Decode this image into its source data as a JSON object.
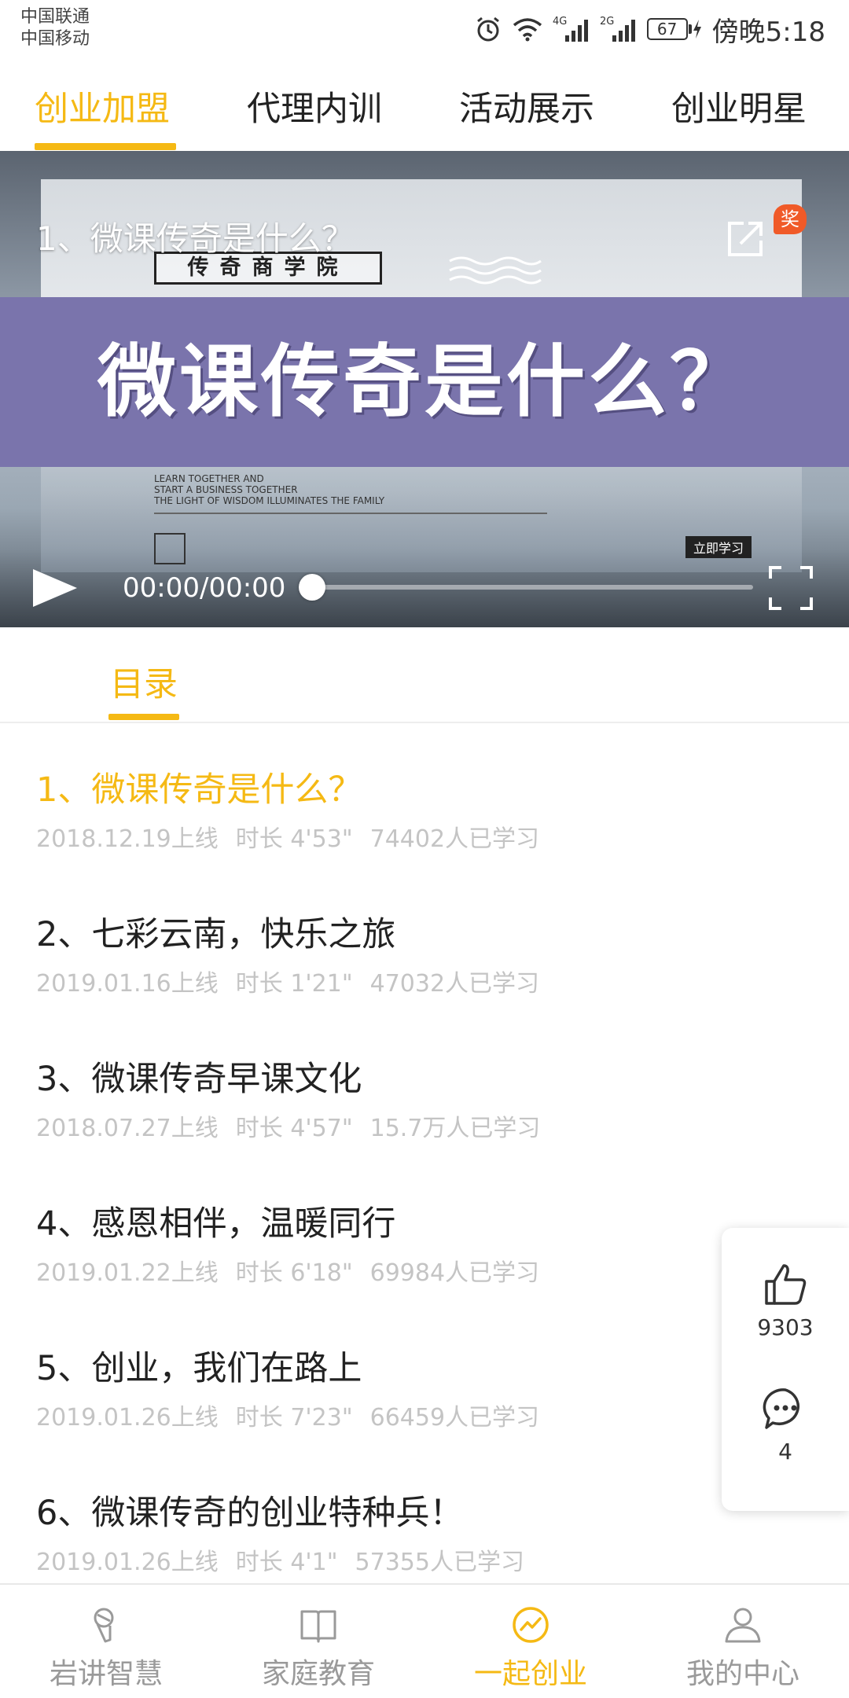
{
  "status_bar": {
    "carrier_1": "中国联通",
    "carrier_2": "中国移动",
    "network_4g": "4G",
    "network_2g": "2G",
    "battery": "67",
    "time": "傍晚5:18"
  },
  "top_tabs": [
    {
      "label": "创业加盟",
      "active": true
    },
    {
      "label": "代理内训",
      "active": false
    },
    {
      "label": "活动展示",
      "active": false
    },
    {
      "label": "创业明星",
      "active": false
    }
  ],
  "video": {
    "title": "1、微课传奇是什么？",
    "poster_academy": "传奇商学院",
    "poster_title": "微课传奇是什么？",
    "poster_tagline_1": "LEARN TOGETHER AND",
    "poster_tagline_2": "START A BUSINESS TOGETHER",
    "poster_tagline_3": "THE LIGHT OF WISDOM ILLUMINATES THE FAMILY",
    "poster_button": "立即学习",
    "award_badge": "奖",
    "time": "00:00/00:00",
    "progress": 0
  },
  "catalog": {
    "tab_label": "目录"
  },
  "courses": [
    {
      "title": "1、微课传奇是什么？",
      "date": "2018.12.19上线",
      "duration": "时长 4'53\"",
      "learners": "74402人已学习",
      "active": true
    },
    {
      "title": "2、七彩云南，快乐之旅",
      "date": "2019.01.16上线",
      "duration": "时长 1'21\"",
      "learners": "47032人已学习",
      "active": false
    },
    {
      "title": "3、微课传奇早课文化",
      "date": "2018.07.27上线",
      "duration": "时长 4'57\"",
      "learners": "15.7万人已学习",
      "active": false
    },
    {
      "title": "4、感恩相伴，温暖同行",
      "date": "2019.01.22上线",
      "duration": "时长 6'18\"",
      "learners": "69984人已学习",
      "active": false
    },
    {
      "title": "5、创业，我们在路上",
      "date": "2019.01.26上线",
      "duration": "时长 7'23\"",
      "learners": "66459人已学习",
      "active": false
    },
    {
      "title": "6、微课传奇的创业特种兵！",
      "date": "2019.01.26上线",
      "duration": "时长 4'1\"",
      "learners": "57355人已学习",
      "active": false
    }
  ],
  "side_panel": {
    "likes": "9303",
    "comments": "4"
  },
  "bottom_nav": [
    {
      "label": "岩讲智慧",
      "icon": "microphone-icon",
      "active": false
    },
    {
      "label": "家庭教育",
      "icon": "book-icon",
      "active": false
    },
    {
      "label": "一起创业",
      "icon": "trend-icon",
      "active": true
    },
    {
      "label": "我的中心",
      "icon": "person-icon",
      "active": false
    }
  ],
  "colors": {
    "accent": "#f5b914",
    "poster_band": "#7a74ac",
    "award": "#f05a28"
  }
}
